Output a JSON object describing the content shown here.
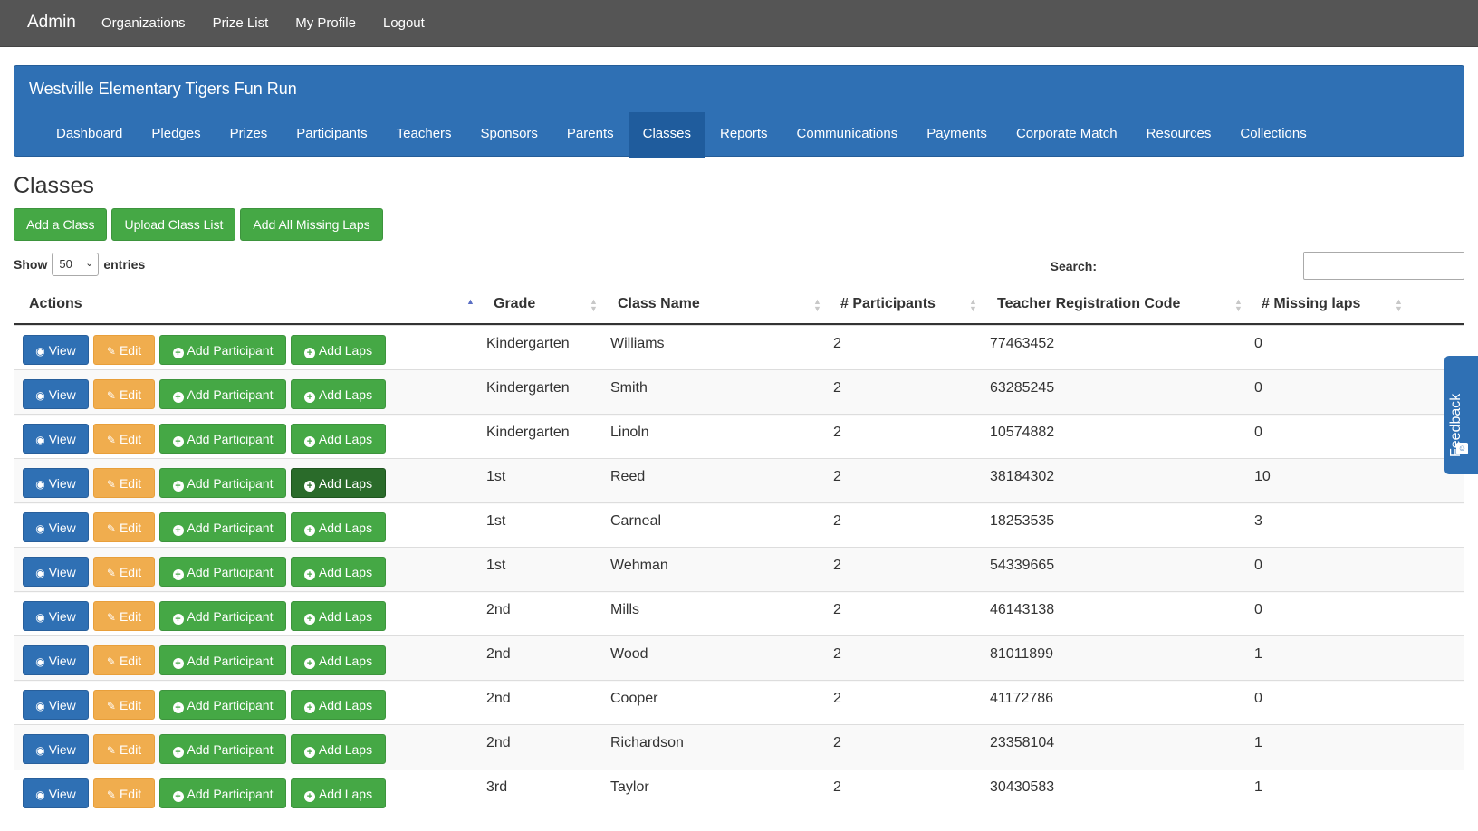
{
  "topnav": {
    "brand": "Admin",
    "links": [
      "Organizations",
      "Prize List",
      "My Profile",
      "Logout"
    ]
  },
  "panel": {
    "title": "Westville Elementary Tigers Fun Run",
    "tabs": [
      "Dashboard",
      "Pledges",
      "Prizes",
      "Participants",
      "Teachers",
      "Sponsors",
      "Parents",
      "Classes",
      "Reports",
      "Communications",
      "Payments",
      "Corporate Match",
      "Resources",
      "Collections"
    ],
    "active_tab": "Classes"
  },
  "page": {
    "title": "Classes",
    "buttons": [
      "Add a Class",
      "Upload Class List",
      "Add All Missing Laps"
    ]
  },
  "length_control": {
    "show": "Show",
    "value": "50",
    "entries": "entries"
  },
  "search": {
    "label": "Search:",
    "value": ""
  },
  "table": {
    "headers": [
      "Actions",
      "Grade",
      "Class Name",
      "# Participants",
      "Teacher Registration Code",
      "# Missing laps"
    ],
    "action_labels": {
      "view": "View",
      "edit": "Edit",
      "add_participant": "Add Participant",
      "add_laps": "Add Laps"
    },
    "rows": [
      {
        "grade": "Kindergarten",
        "class_name": "Williams",
        "participants": "2",
        "code": "77463452",
        "missing": "0"
      },
      {
        "grade": "Kindergarten",
        "class_name": "Smith",
        "participants": "2",
        "code": "63285245",
        "missing": "0"
      },
      {
        "grade": "Kindergarten",
        "class_name": "Linoln",
        "participants": "2",
        "code": "10574882",
        "missing": "0"
      },
      {
        "grade": "1st",
        "class_name": "Reed",
        "participants": "2",
        "code": "38184302",
        "missing": "10"
      },
      {
        "grade": "1st",
        "class_name": "Carneal",
        "participants": "2",
        "code": "18253535",
        "missing": "3"
      },
      {
        "grade": "1st",
        "class_name": "Wehman",
        "participants": "2",
        "code": "54339665",
        "missing": "0"
      },
      {
        "grade": "2nd",
        "class_name": "Mills",
        "participants": "2",
        "code": "46143138",
        "missing": "0"
      },
      {
        "grade": "2nd",
        "class_name": "Wood",
        "participants": "2",
        "code": "81011899",
        "missing": "1"
      },
      {
        "grade": "2nd",
        "class_name": "Cooper",
        "participants": "2",
        "code": "41172786",
        "missing": "0"
      },
      {
        "grade": "2nd",
        "class_name": "Richardson",
        "participants": "2",
        "code": "23358104",
        "missing": "1"
      },
      {
        "grade": "3rd",
        "class_name": "Taylor",
        "participants": "2",
        "code": "30430583",
        "missing": "1"
      }
    ]
  },
  "feedback": {
    "label": "Feedback"
  },
  "colors": {
    "primary": "#2f70b4",
    "success": "#45a845",
    "warning": "#f0ad4e",
    "navbar": "#555555"
  }
}
